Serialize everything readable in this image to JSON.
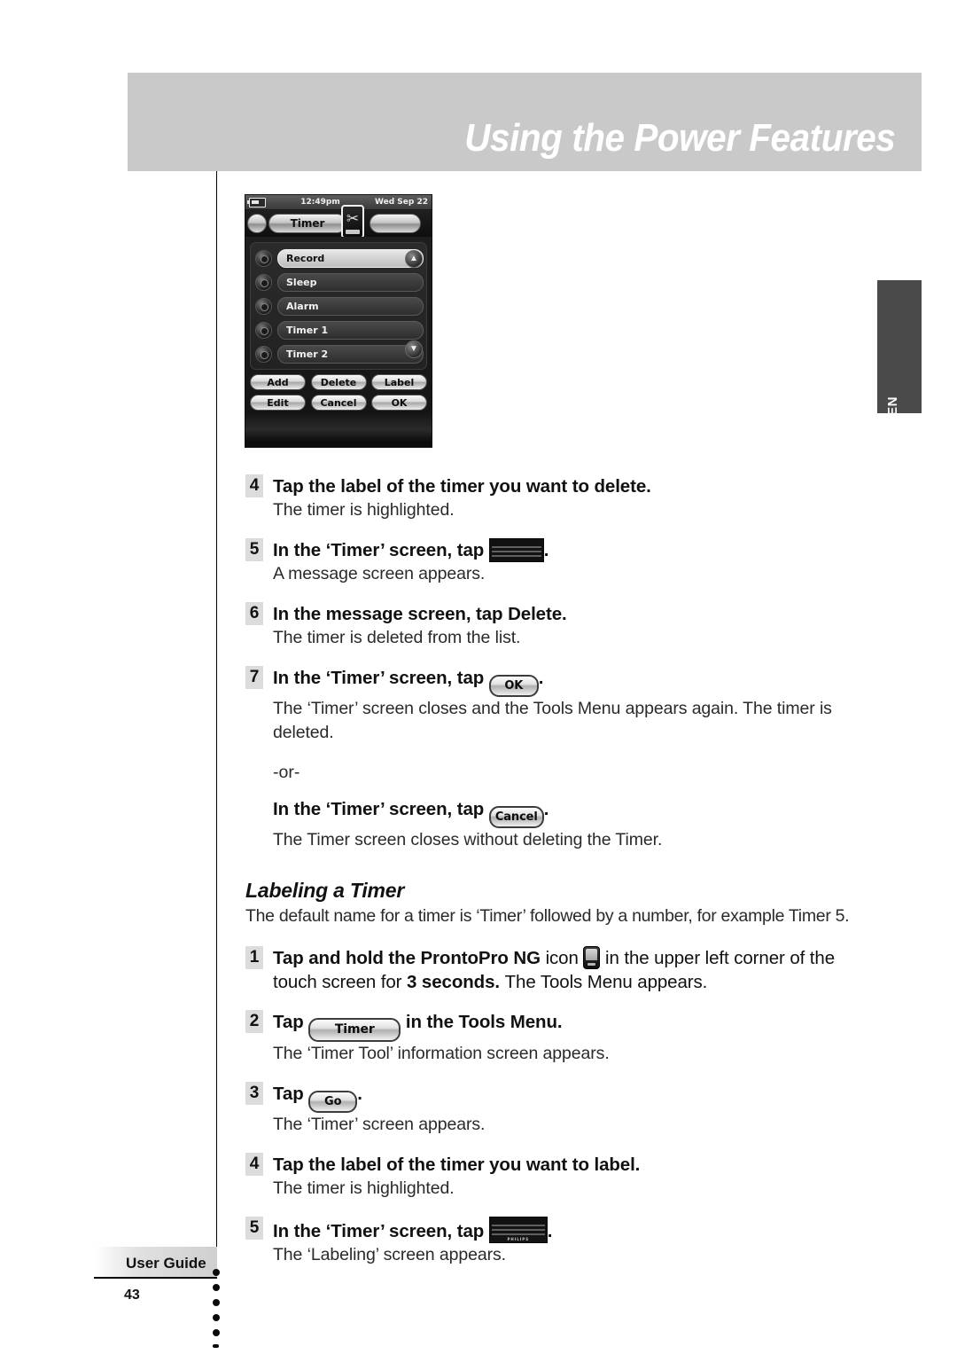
{
  "header": {
    "title": "Using the Power Features"
  },
  "side_tab": {
    "language": "EN"
  },
  "device_screenshot": {
    "status_bar": {
      "battery_icon": "battery-icon",
      "time": "12:49pm",
      "center_icon": "wrench-device-icon",
      "date": "Wed Sep 22"
    },
    "active_tab": "Timer",
    "list_items": [
      "Record",
      "Sleep",
      "Alarm",
      "Timer 1",
      "Timer 2"
    ],
    "selected_item": "Record",
    "scroll_up_icon": "arrow-up-icon",
    "scroll_down_icon": "arrow-down-icon",
    "buttons_row1": [
      "Add",
      "Delete",
      "Label"
    ],
    "buttons_row2": [
      "Edit",
      "Cancel",
      "OK"
    ]
  },
  "steps_delete": [
    {
      "num": "4",
      "main_pre": "Tap the label of the timer you want to delete.",
      "sub": "The timer is highlighted."
    },
    {
      "num": "5",
      "main_pre": "In the ‘Timer’ screen, tap",
      "main_post": ".",
      "inline": "message-screen-thumbnail",
      "sub": "A message screen appears."
    },
    {
      "num": "6",
      "main_pre": "In the message screen, tap",
      "main_bold": "Delete",
      "main_post": ".",
      "sub": "The timer is deleted from the list."
    },
    {
      "num": "7",
      "main_pre": "In the ‘Timer’ screen, tap",
      "inline_button": "OK",
      "main_post": ".",
      "sub": "The ‘Timer’ screen closes and the Tools Menu appears again. The timer is deleted."
    }
  ],
  "or_divider": "-or-",
  "or_step": {
    "main_pre": "In the ‘Timer’ screen, tap",
    "inline_button": "Cancel",
    "main_post": ".",
    "sub": "The Timer screen closes without deleting the Timer."
  },
  "labeling_section": {
    "heading": "Labeling a Timer",
    "intro": "The default name for a timer is ‘Timer’ followed by a number, for example Timer 5.",
    "steps": [
      {
        "num": "1",
        "part1": "Tap and hold the",
        "bold1": "ProntoPro NG",
        "part2": "icon",
        "inline": "prontopro-device-icon",
        "part3": "in the upper left corner of the",
        "part4": "touch screen for",
        "bold2": "3 seconds.",
        "part5": "The Tools Menu appears."
      },
      {
        "num": "2",
        "main_pre": "Tap",
        "inline_button": "Timer",
        "main_post": "in the Tools Menu.",
        "sub": "The ‘Timer Tool’ information screen appears."
      },
      {
        "num": "3",
        "main_pre": "Tap",
        "inline_button": "Go",
        "main_post": ".",
        "sub": "The ‘Timer’ screen appears."
      },
      {
        "num": "4",
        "main_pre": "Tap the label of the timer you want to label.",
        "sub": "The timer is highlighted."
      },
      {
        "num": "5",
        "main_pre": "In the ‘Timer’ screen, tap",
        "main_post": ".",
        "inline": "labeling-screen-thumbnail",
        "sub": "The ‘Labeling’ screen appears."
      }
    ]
  },
  "footer": {
    "label": "User Guide",
    "page_number": "43",
    "thumbnail_caption": "PHILIPS"
  }
}
